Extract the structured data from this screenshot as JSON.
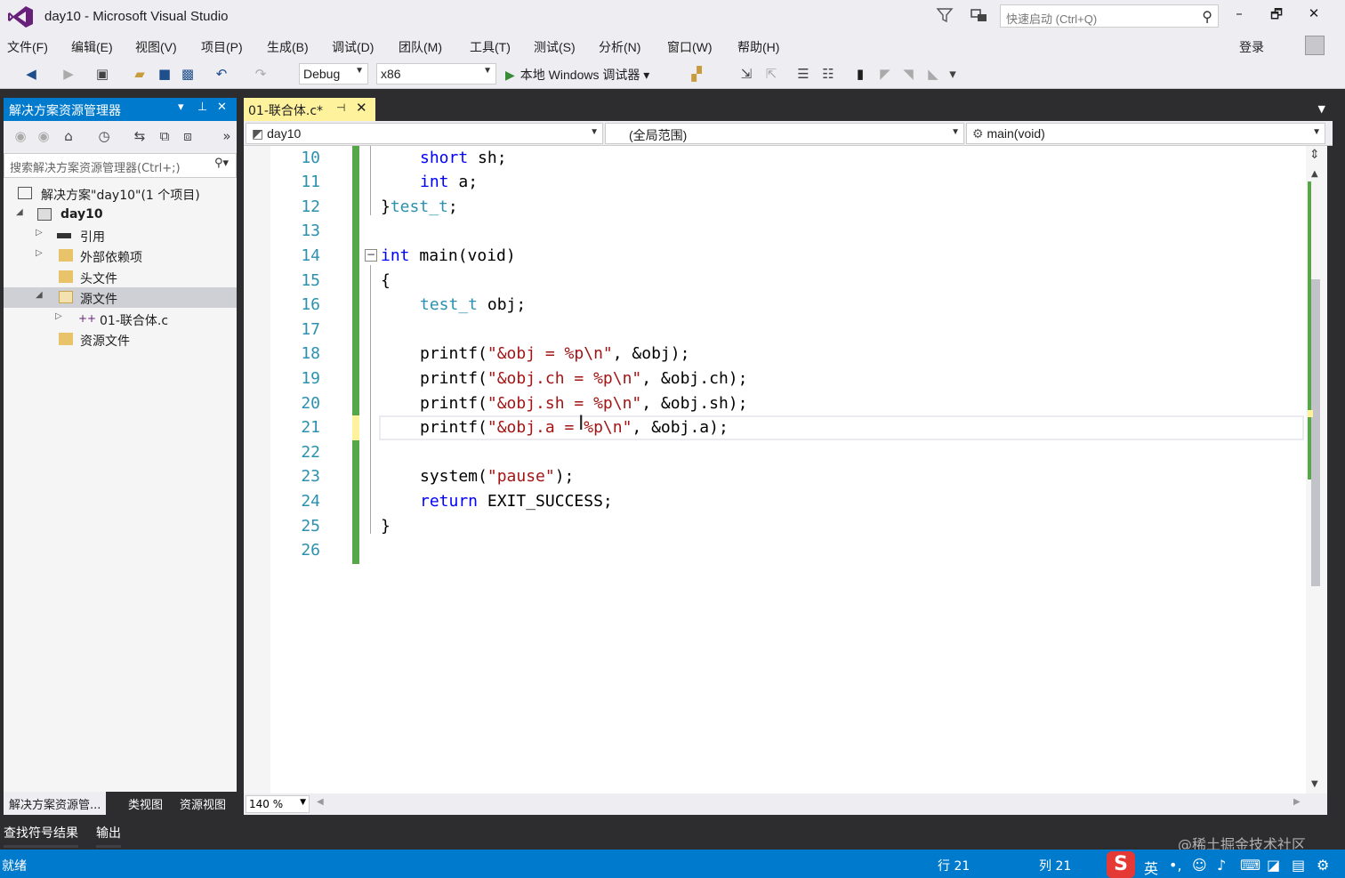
{
  "window": {
    "title": "day10 - Microsoft Visual Studio",
    "quick_launch_placeholder": "快速启动 (Ctrl+Q)",
    "minimize": "–",
    "restore": "🗗",
    "close": "✕"
  },
  "menu": {
    "items": [
      "文件(F)",
      "编辑(E)",
      "视图(V)",
      "项目(P)",
      "生成(B)",
      "调试(D)",
      "团队(M)",
      "工具(T)",
      "测试(S)",
      "分析(N)",
      "窗口(W)",
      "帮助(H)"
    ],
    "login": "登录"
  },
  "toolbar": {
    "config": "Debug",
    "platform": "x86",
    "run_label": "本地 Windows 调试器"
  },
  "solution_explorer": {
    "title": "解决方案资源管理器",
    "search_placeholder": "搜索解决方案资源管理器(Ctrl+;)",
    "tree": [
      {
        "label": "解决方案\"day10\"(1 个项目)",
        "icon": "solution-icon"
      },
      {
        "label": "day10",
        "icon": "project-icon"
      },
      {
        "label": "引用",
        "icon": "references-icon"
      },
      {
        "label": "外部依赖项",
        "icon": "external-deps-icon"
      },
      {
        "label": "头文件",
        "icon": "folder-icon"
      },
      {
        "label": "源文件",
        "icon": "folder-icon",
        "selected": true
      },
      {
        "label": "01-联合体.c",
        "icon": "cpp-file-icon"
      },
      {
        "label": "资源文件",
        "icon": "folder-icon"
      }
    ],
    "tabs": [
      "解决方案资源管...",
      "类视图",
      "资源视图"
    ]
  },
  "editor": {
    "tab_label": "01-联合体.c*",
    "nav_project": "day10",
    "nav_scope": "(全局范围)",
    "nav_member": "main(void)",
    "zoom": "140 %",
    "line_numbers": [
      "10",
      "11",
      "12",
      "13",
      "14",
      "15",
      "16",
      "17",
      "18",
      "19",
      "20",
      "21",
      "22",
      "23",
      "24",
      "25",
      "26"
    ],
    "code": {
      "l10_type": "short",
      "l10_rest": " sh;",
      "l11_type": "int",
      "l11_rest": " a;",
      "l12_brace": "}",
      "l12_name": "test_t",
      "l12_end": ";",
      "l14_kw": "int",
      "l14_rest": " main(void)",
      "l15": "{",
      "l16_type": "test_t",
      "l16_rest": " obj;",
      "l18_fn": "printf(",
      "l18_str": "\"&obj = %p\\n\"",
      "l18_rest": ", &obj);",
      "l19_fn": "printf(",
      "l19_str": "\"&obj.ch = %p\\n\"",
      "l19_rest": ", &obj.ch);",
      "l20_fn": "printf(",
      "l20_str": "\"&obj.sh = %p\\n\"",
      "l20_rest": ", &obj.sh);",
      "l21_fn": "printf(",
      "l21_str": "\"&obj.a = %p\\n\"",
      "l21_rest": ", &obj.a);",
      "l23_fn": "system(",
      "l23_str": "\"pause\"",
      "l23_rest": ");",
      "l24_kw": "return",
      "l24_rest": " EXIT_SUCCESS;",
      "l25": "}"
    }
  },
  "bottom_tabs": [
    "查找符号结果",
    "输出"
  ],
  "status": {
    "ready": "就绪",
    "line": "行 21",
    "col": "列 21"
  },
  "ime": {
    "logo": "S",
    "lang": "英"
  },
  "watermark": "@稀土掘金技术社区"
}
